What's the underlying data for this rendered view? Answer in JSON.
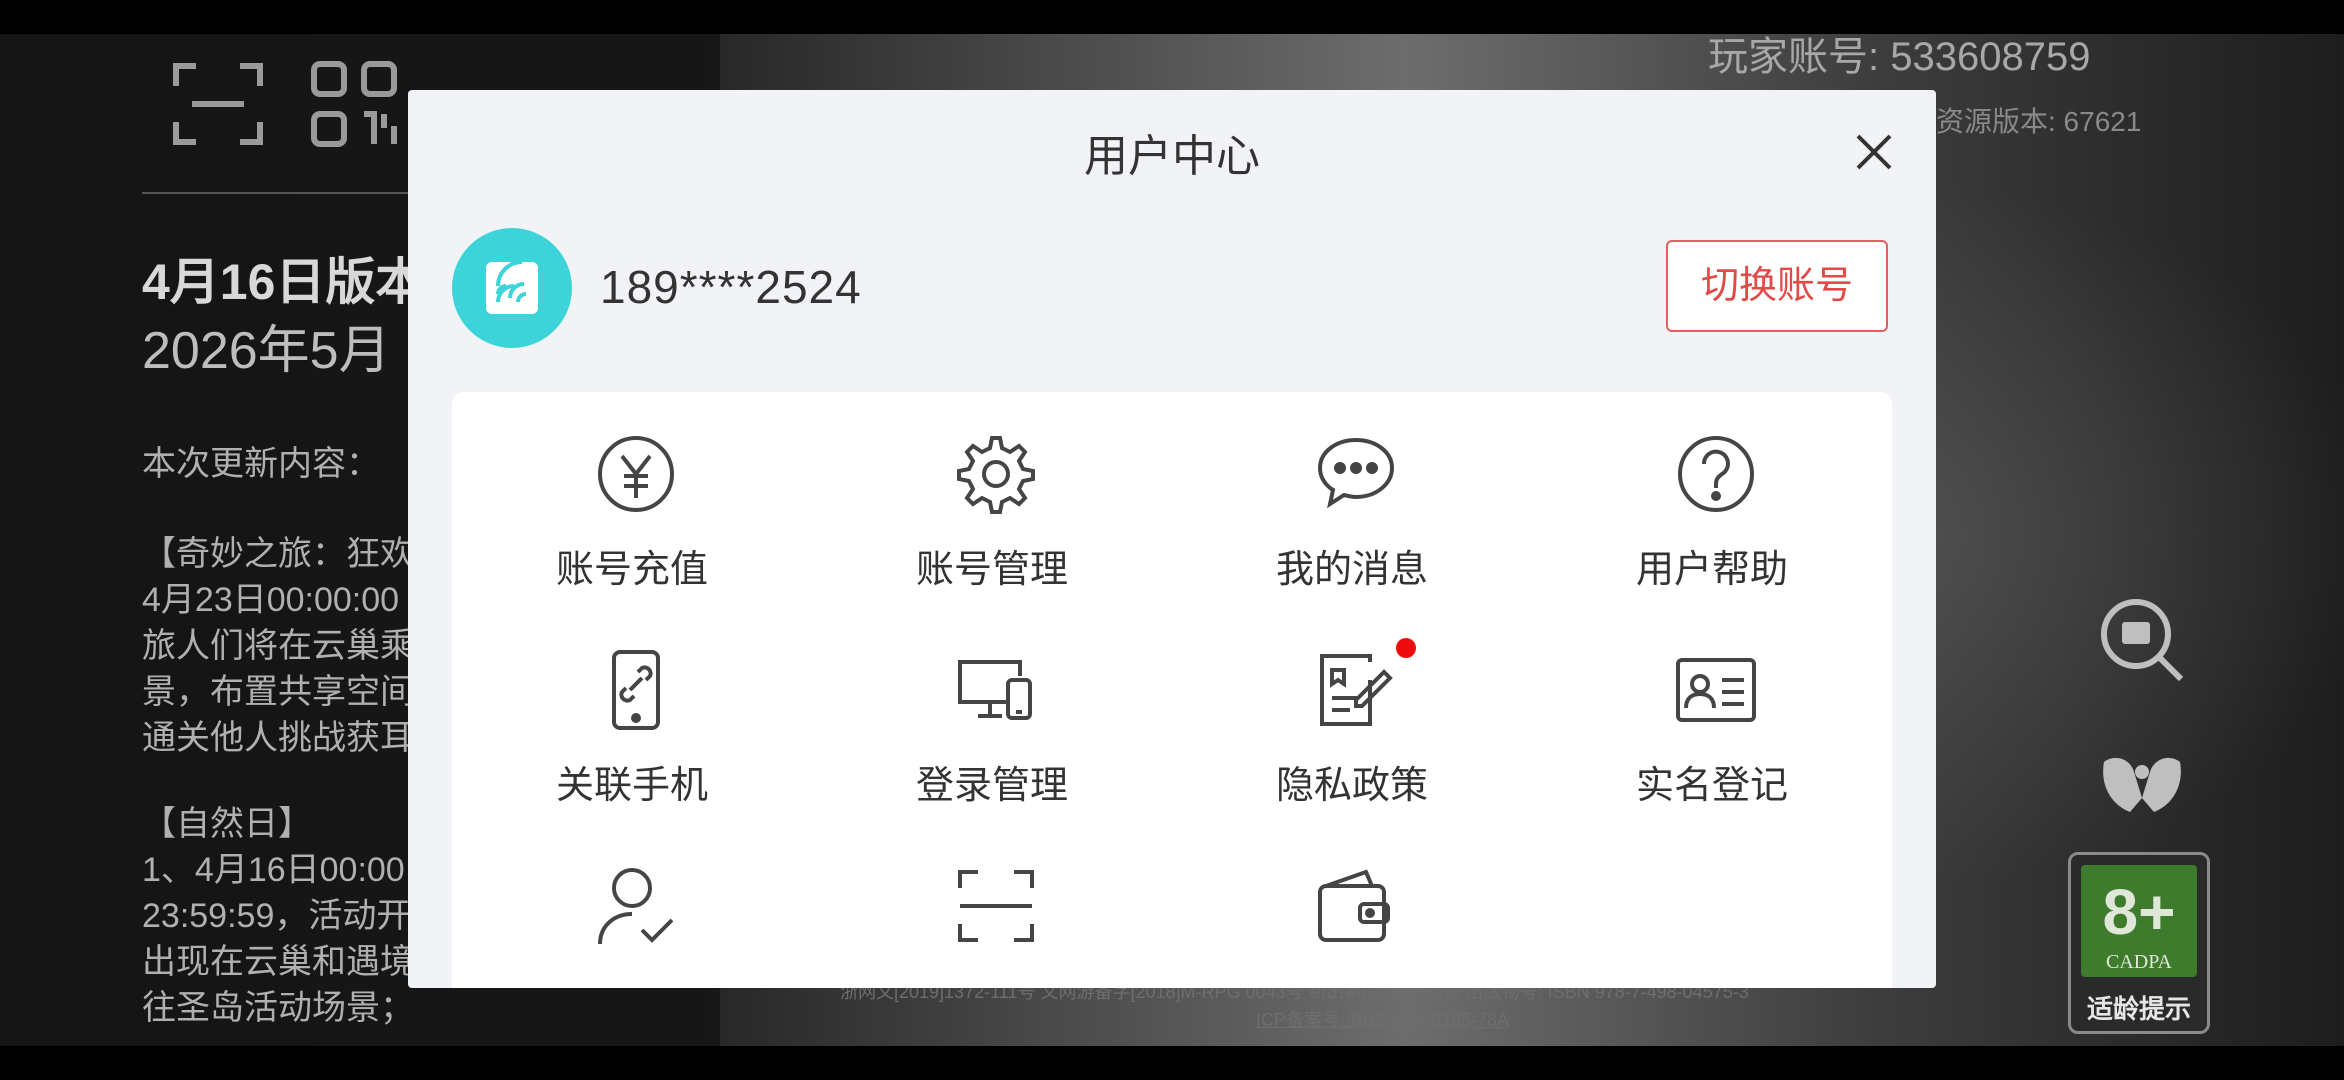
{
  "background": {
    "update_title": "4月16日版本",
    "update_date": "2026年5月",
    "content_header": "本次更新内容：",
    "lines": [
      "【奇妙之旅：狂欢",
      "4月23日00:00:00",
      "旅人们将在云巢乘",
      "景，布置共享空间",
      "通关他人挑战获耳",
      "【自然日】",
      "1、4月16日00:00",
      "23:59:59，活动开",
      "出现在云巢和遇境",
      "往圣岛活动场景；"
    ],
    "player_id": "玩家账号: 533608759",
    "resource_version": "资源版本: 67621",
    "footer_license": "浙网文[2019]1372-111号 文网游备字[2018]M-RPG 0043号 新出审[2018]655号 出版物号: ISBN 978-7-498-04575-3",
    "icp": "ICP备案号:浙B2-20090185-78A",
    "age_rating": {
      "age": "8+",
      "org": "CADPA",
      "tip": "适龄提示",
      "color": "#3f7b2c"
    }
  },
  "modal": {
    "title": "用户中心",
    "user": {
      "phone": "189****2524",
      "avatar_color": "#3dd4d9"
    },
    "switch_account_label": "切换账号",
    "menu": [
      {
        "label": "账号充值",
        "icon": "yuan-icon"
      },
      {
        "label": "账号管理",
        "icon": "gear-icon"
      },
      {
        "label": "我的消息",
        "icon": "chat-bubble-icon"
      },
      {
        "label": "用户帮助",
        "icon": "question-icon"
      },
      {
        "label": "关联手机",
        "icon": "phone-link-icon"
      },
      {
        "label": "登录管理",
        "icon": "devices-icon"
      },
      {
        "label": "隐私政策",
        "icon": "document-edit-icon",
        "badge": "red-dot"
      },
      {
        "label": "实名登记",
        "icon": "id-card-icon"
      },
      {
        "label": "",
        "icon": "user-check-icon"
      },
      {
        "label": "",
        "icon": "scan-icon"
      },
      {
        "label": "",
        "icon": "wallet-icon"
      }
    ]
  }
}
